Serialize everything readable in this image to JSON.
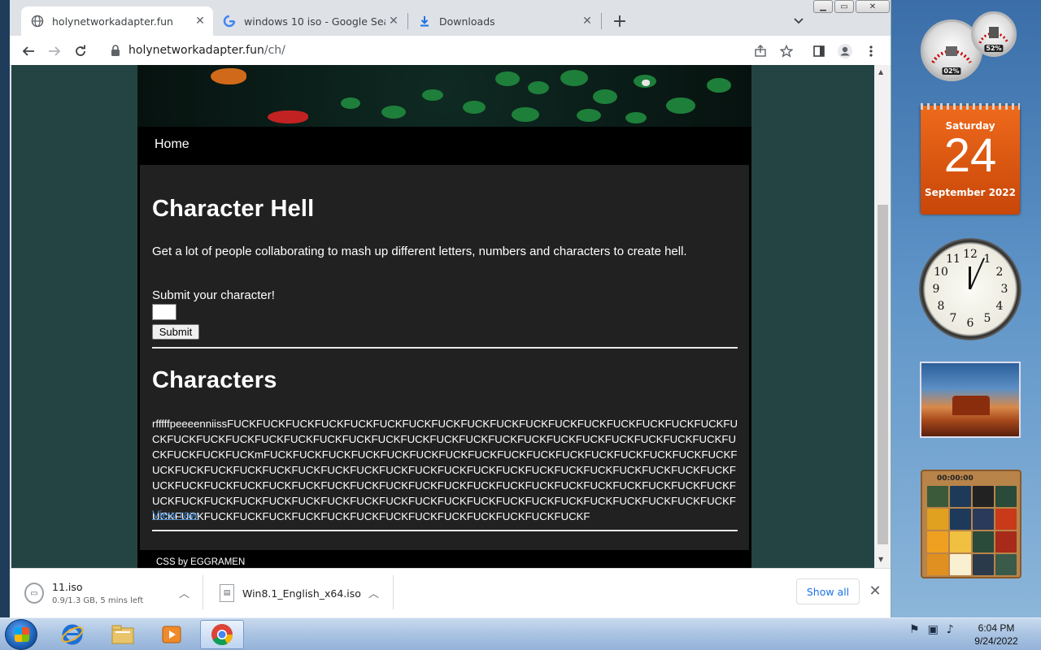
{
  "browser": {
    "tabs": [
      {
        "title": "holynetworkadapter.fun",
        "active": true
      },
      {
        "title": "windows 10 iso - Google Search",
        "active": false
      },
      {
        "title": "Downloads",
        "active": false
      }
    ],
    "url_host": "holynetworkadapter.fun",
    "url_path": "/ch/"
  },
  "page": {
    "nav_home": "Home",
    "heading": "Character Hell",
    "description": "Get a lot of people collaborating to mash up different letters, numbers and characters to create hell.",
    "submit_label": "Submit your character!",
    "submit_button": "Submit",
    "characters_heading": "Characters",
    "characters_text": "rfffffpeeeenniissFUCKFUCKFUCKFUCKFUCKFUCKFUCKFUCKFUCKFUCKFUCKFUCKFUCKFUCKFUCKFUCKFUCKFUCKFUCKFUCKFUCKFUCKFUCKFUCKFUCKFUCKFUCKFUCKFUCKFUCKFUCKFUCKFUCKFUCKFUCKFUCKFUCKFUCKFUCKFUCKFUCKmFUCKFUCKFUCKFUCKFUCKFUCKFUCKFUCKFUCKFUCKFUCKFUCKFUCKFUCKFUCKFUCKFUCKFUCKFUCKFUCKFUCKFUCKFUCKFUCKFUCKFUCKFUCKFUCKFUCKFUCKFUCKFUCKFUCKFUCKFUCKFUCKFUCKFUCKFUCKFUCKFUCKFUCKFUCKFUCKFUCKFUCKFUCKFUCKFUCKFUCKFUCKFUCKFUCKFUCKFUCKFUCKFUCKFUCKFUCKFUCKFUCKFUCKFUCKFUCKFUCKFUCKFUCKFUCKFUCKFUCKFUCKFUCKFUCKFUCKFUCKFUCKFUCKFUCKFUCKFUCKFUCKFUCKFUCKFUCKFUCKFUCKFUCKFUCKFUCKFUCKFUCKF",
    "view_raw": "View raw",
    "footer": "CSS by EGGRAMEN"
  },
  "downloads": [
    {
      "name": "11.iso",
      "status": "0.9/1.3 GB, 5 mins left"
    },
    {
      "name": "Win8.1_English_x64.iso",
      "status": ""
    }
  ],
  "downloads_show_all": "Show all",
  "gadgets": {
    "cpu_percent": "02%",
    "mem_percent": "52%",
    "calendar_day": "Saturday",
    "calendar_date": "24",
    "calendar_month": "September 2022",
    "puzzle_time": "00:00:00"
  },
  "taskbar": {
    "time": "6:04 PM",
    "date": "9/24/2022"
  },
  "colors": {
    "page_background": "#244443",
    "content_background": "#212121",
    "link": "#4a8fd6",
    "chrome_accent": "#1a73e8"
  }
}
